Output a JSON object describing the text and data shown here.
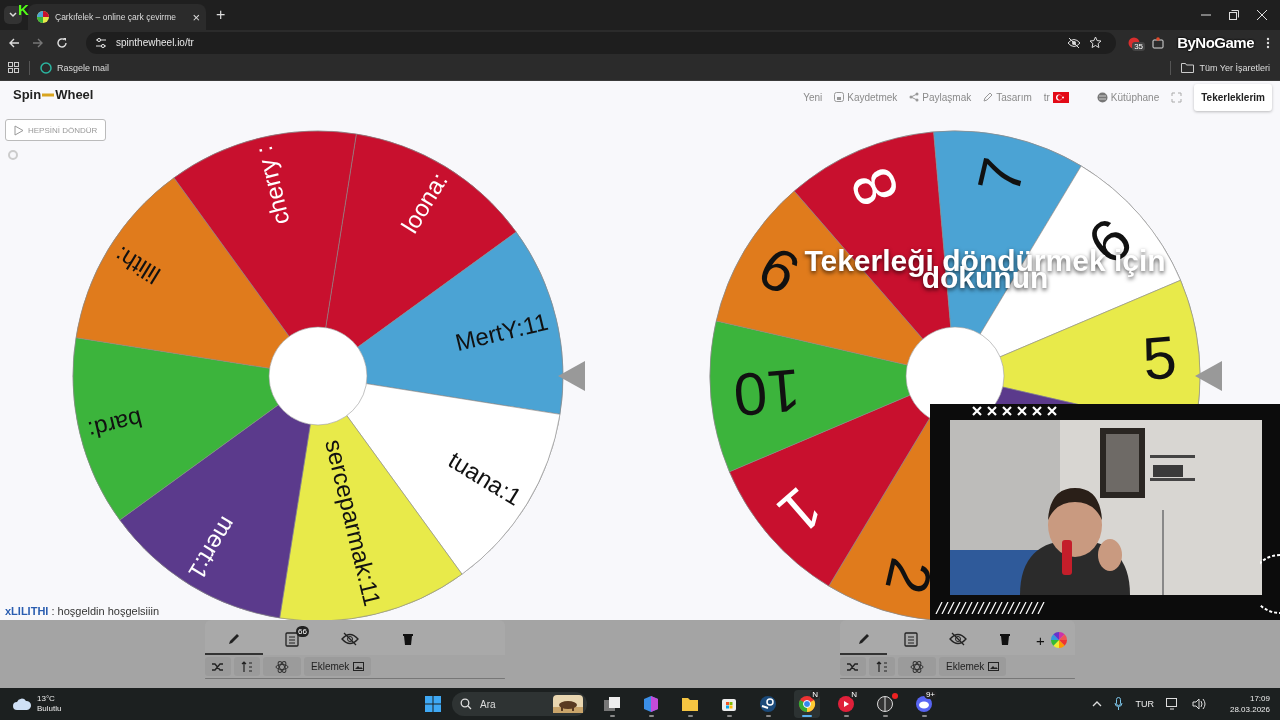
{
  "browser": {
    "stream_badge": "K",
    "tab": {
      "title": "Çarkıfelek – online çark çevirme",
      "close": "×"
    },
    "new_tab": "+",
    "address": "spinthewheel.io/tr",
    "extension_badge": "35",
    "overlay_logo": "ByNoGame",
    "bookmarks": [
      {
        "label": "Rasgele mail"
      }
    ],
    "all_bookmarks": "Tüm Yer İşaretleri"
  },
  "header": {
    "logo": [
      "Spin",
      "Wheel"
    ],
    "nav": [
      {
        "kind": "new",
        "label": "Yeni"
      },
      {
        "kind": "save",
        "label": "Kaydetmek"
      },
      {
        "kind": "share",
        "label": "Paylaşmak"
      },
      {
        "kind": "design",
        "label": "Tasarım"
      },
      {
        "kind": "language",
        "label": "tr"
      },
      {
        "kind": "library",
        "label": "Kütüphane"
      }
    ],
    "my_wheels": "Tekerleklerim"
  },
  "spin_all": "HEPSİNİ DÖNDÜR",
  "wheels": [
    {
      "kind": "names",
      "segments": [
        {
          "label": "loona:",
          "color": "#c8102e"
        },
        {
          "label": "MertY:11",
          "color": "#4ba3d4"
        },
        {
          "label": "tuana:1",
          "color": "#ffffff"
        },
        {
          "label": "serceparmak:11",
          "color": "#e8ea4a"
        },
        {
          "label": "mert:1",
          "color": "#5b3a8c"
        },
        {
          "label": "bard:",
          "color": "#3cb43c"
        },
        {
          "label": "lilith:",
          "color": "#e07b1c"
        },
        {
          "label": "cherry :",
          "color": "#c8102e"
        }
      ]
    },
    {
      "kind": "numbers",
      "overlay": [
        "Tekerleği döndürmek için",
        "dokunun"
      ],
      "segments": [
        {
          "label": "2",
          "color": "#e07b1c"
        },
        {
          "label": "1",
          "color": "#c8102e"
        },
        {
          "label": "10",
          "color": "#3cb43c"
        },
        {
          "label": "9",
          "color": "#e07b1c"
        },
        {
          "label": "8",
          "color": "#c8102e"
        },
        {
          "label": "7",
          "color": "#4ba3d4"
        },
        {
          "label": "6",
          "color": "#ffffff"
        },
        {
          "label": "5",
          "color": "#e8ea4a"
        },
        {
          "color": "#5b3a8c"
        }
      ]
    }
  ],
  "chat": [
    {
      "user": "xLILITHI",
      "message": ": hoşgeldin hoşgelsiiin"
    }
  ],
  "toolbars": [
    {
      "tabs": [
        {
          "kind": "edit",
          "selected": true
        },
        {
          "kind": "list",
          "selected": false,
          "badge": "66"
        },
        {
          "kind": "hide",
          "selected": false
        },
        {
          "kind": "delete",
          "selected": false
        }
      ],
      "add": "Eklemek"
    },
    {
      "tabs": [
        {
          "kind": "edit",
          "selected": true
        },
        {
          "kind": "list",
          "selected": false
        },
        {
          "kind": "hide",
          "selected": false
        },
        {
          "kind": "delete",
          "selected": false
        }
      ],
      "extras": [
        {
          "kind": "plus",
          "label": "+"
        },
        {
          "kind": "colors"
        }
      ],
      "add": "Eklemek"
    }
  ],
  "taskbar": {
    "weather": {
      "temperature": "13°C",
      "condition": "Bulutlu"
    },
    "search": {
      "placeholder": "Ara"
    },
    "apps": [
      {
        "kind": "taskview",
        "selected": false
      },
      {
        "kind": "office",
        "selected": false
      },
      {
        "kind": "files",
        "selected": false
      },
      {
        "kind": "store",
        "selected": false
      },
      {
        "kind": "steam",
        "selected": false
      },
      {
        "kind": "chrome",
        "selected": true,
        "badge": "N"
      },
      {
        "kind": "music",
        "selected": false,
        "badge": "N"
      },
      {
        "kind": "app",
        "selected": false,
        "dot": true
      },
      {
        "kind": "discord",
        "selected": false,
        "badge": "9+"
      }
    ],
    "language": "TUR",
    "time": "17:09",
    "date": "28.03.2026"
  }
}
